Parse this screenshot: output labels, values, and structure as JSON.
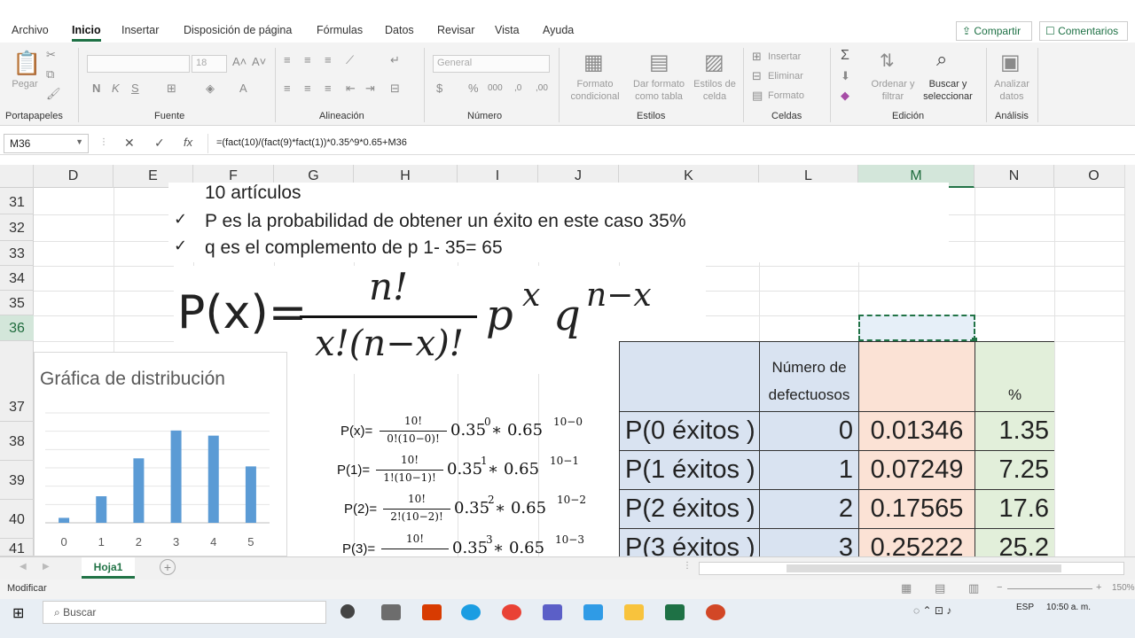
{
  "menu": {
    "tabs": [
      "Archivo",
      "Inicio",
      "Insertar",
      "Disposición de página",
      "Fórmulas",
      "Datos",
      "Revisar",
      "Vista",
      "Ayuda"
    ],
    "active": "Inicio",
    "share": "Compartir",
    "comments": "Comentarios"
  },
  "ribbon": {
    "paste": "Pegar",
    "font_name": "",
    "font_size": "18",
    "number_format": "General",
    "format_cond": "Formato condicional",
    "format_table": "Dar formato como tabla",
    "cell_styles": "Estilos de celda",
    "insert": "Insertar",
    "delete": "Eliminar",
    "format": "Formato",
    "sort_filter": "Ordenar y filtrar",
    "find_select": "Buscar y seleccionar",
    "analyze": "Analizar datos",
    "groups": {
      "clipboard": "Portapapeles",
      "font": "Fuente",
      "alignment": "Alineación",
      "number": "Número",
      "styles": "Estilos",
      "cells": "Celdas",
      "editing": "Edición",
      "analysis": "Análisis"
    }
  },
  "formula_bar": {
    "name_box": "M36",
    "formula": "=(fact(10)/(fact(9)*fact(1))*0.35^9*0.65+M36"
  },
  "columns": [
    "D",
    "E",
    "F",
    "G",
    "H",
    "I",
    "J",
    "K",
    "L",
    "M",
    "N",
    "O"
  ],
  "rows": [
    "31",
    "32",
    "33",
    "34",
    "35",
    "36",
    "37",
    "38",
    "39",
    "40",
    "41"
  ],
  "slide_text": {
    "line1": "10 artículos",
    "line2": "P es la probabilidad de obtener un éxito en este caso 35%",
    "line3": "q es el complemento de p 1- 35= 65",
    "check": "✓",
    "formula_lhs": "P(x)=",
    "formula_num": "n!",
    "formula_den": "x!(n−x)!",
    "formula_rest_p": "p",
    "formula_exp_x": "x",
    "formula_rest_q": "q",
    "formula_exp_nx": "n−x"
  },
  "small_formulas": [
    {
      "lhs": "P(x)=",
      "num": "10!",
      "den": "0!(10−0)!",
      "base": "0.35",
      "exp": "0",
      "mid": " ∗ 0.65",
      "exp2": "10−0"
    },
    {
      "lhs": "P(1)=",
      "num": "10!",
      "den": "1!(10−1)!",
      "base": "0.35",
      "exp": "1",
      "mid": " ∗ 0.65",
      "exp2": "10−1"
    },
    {
      "lhs": "P(2)=",
      "num": "10!",
      "den": "2!(10−2)!",
      "base": "0.35",
      "exp": "2",
      "mid": " ∗ 0.65",
      "exp2": "10−2"
    },
    {
      "lhs": "P(3)=",
      "num": "10!",
      "den": "",
      "base": "0.35",
      "exp": "3",
      "mid": " ∗ 0.65",
      "exp2": "10−3"
    }
  ],
  "table": {
    "header_defects": "Número de defectuosos",
    "header_pct": "%",
    "rows": [
      {
        "label": "P(0 éxitos )",
        "n": "0",
        "p": "0.01346",
        "pct": "1.35"
      },
      {
        "label": "P(1 éxitos )",
        "n": "1",
        "p": "0.07249",
        "pct": "7.25"
      },
      {
        "label": "P(2 éxitos )",
        "n": "2",
        "p": "0.17565",
        "pct": "17.6"
      },
      {
        "label": "P(3 éxitos )",
        "n": "3",
        "p": "0.25222",
        "pct": "25.2"
      }
    ]
  },
  "chart_data": {
    "type": "bar",
    "title": "Gráfica de distribución",
    "categories": [
      "0",
      "1",
      "2",
      "3",
      "4",
      "5"
    ],
    "values": [
      1.35,
      7.25,
      17.6,
      25.2,
      23.8,
      15.4
    ],
    "ylim": [
      0,
      30
    ],
    "grid": true,
    "color": "#5b9bd5"
  },
  "sheet_tab": "Hoja1",
  "status": {
    "mode": "Modificar",
    "zoom": "150%"
  },
  "taskbar": {
    "search": "Buscar",
    "lang": "ESP",
    "time": "10:50 a. m."
  }
}
